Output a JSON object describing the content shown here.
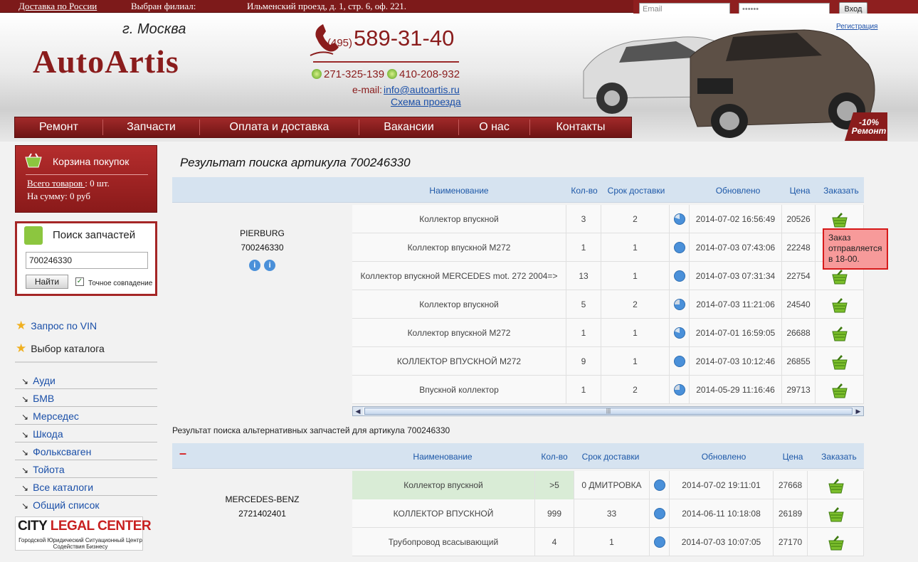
{
  "topbar": {
    "delivery": "Доставка по России",
    "branch_label": "Выбран филиал:",
    "branch_address": "Ильменский проезд, д. 1, стр. 6, оф. 221.",
    "email_placeholder": "Email",
    "password_mask": "••••••",
    "login_button": "Вход",
    "register": "Регистрация"
  },
  "header": {
    "city": "г. Москва",
    "logo": "AutoArtis",
    "code": "(495)",
    "phone": "589-31-40",
    "phone2": "271-325-139",
    "phone3": "410-208-932",
    "email_label": "e-mail:",
    "email": "info@autoartis.ru",
    "scheme": "Схема проезда",
    "badge_line1": "-10%",
    "badge_line2": "Ремонт"
  },
  "nav": [
    "Ремонт",
    "Запчасти",
    "Оплата и доставка",
    "Вакансии",
    "О нас",
    "Контакты"
  ],
  "cart": {
    "title": "Корзина покупок",
    "items_label": "Всего товаров ",
    "items_value": ": 0 шт.",
    "sum": "На сумму: 0 руб"
  },
  "search": {
    "title": "Поиск запчастей",
    "query": "700246330",
    "button": "Найти",
    "exact": "Точное совпадение",
    "exact_checked": true
  },
  "links": {
    "vin": "Запрос по VIN",
    "catalog": "Выбор каталога"
  },
  "catalogs": [
    "Ауди",
    "БМВ",
    "Мерседес",
    "Шкода",
    "Фольксваген",
    "Тойота",
    "Все каталоги",
    "Общий список"
  ],
  "banner": {
    "part1": "CITY ",
    "part2": "LEGAL CENTER",
    "sub": "Городской Юридический Ситуационный Центр Содействия Бизнесу"
  },
  "main": {
    "title": "Результат поиска артикула 700246330",
    "columns": [
      "Наименование",
      "Кол-во",
      "Срок доставки",
      "Обновлено",
      "Цена",
      "Заказать"
    ],
    "brand": "PIERBURG",
    "article": "700246330",
    "rows": [
      {
        "name": "Коллектор впускной",
        "qty": "3",
        "days": "2",
        "pie": "q",
        "updated": "2014-07-02 16:56:49",
        "price": "20526"
      },
      {
        "name": "Коллектор впускной M272",
        "qty": "1",
        "days": "1",
        "pie": "f",
        "updated": "2014-07-03 07:43:06",
        "price": "22248"
      },
      {
        "name": "Коллектор впускной MERCEDES mot. 272 2004=>",
        "qty": "13",
        "days": "1",
        "pie": "f",
        "updated": "2014-07-03 07:31:34",
        "price": "22754"
      },
      {
        "name": "Коллектор впускной",
        "qty": "5",
        "days": "2",
        "pie": "h",
        "updated": "2014-07-03 11:21:06",
        "price": "24540"
      },
      {
        "name": "Коллектор впускной M272",
        "qty": "1",
        "days": "1",
        "pie": "q",
        "updated": "2014-07-01 16:59:05",
        "price": "26688"
      },
      {
        "name": "КОЛЛЕКТОР ВПУСКНОЙ M272",
        "qty": "9",
        "days": "1",
        "pie": "f",
        "updated": "2014-07-03 10:12:46",
        "price": "26855"
      },
      {
        "name": "Впускной коллектор",
        "qty": "1",
        "days": "2",
        "pie": "h",
        "updated": "2014-05-29 11:16:46",
        "price": "29713"
      }
    ],
    "tooltip": "Заказ отправляется в 18-00."
  },
  "alt": {
    "title": "Результат поиска альтернативных запчастей для артикула 700246330",
    "collapse": "–",
    "columns": [
      "Наименование",
      "Кол-во",
      "Срок доставки",
      "Обновлено",
      "Цена",
      "Заказать"
    ],
    "brand": "MERCEDES-BENZ",
    "article": "2721402401",
    "rows": [
      {
        "name": "Коллектор впускной",
        "qty": ">5",
        "days": "0 ДМИТРОВКА",
        "updated": "2014-07-02 19:11:01",
        "price": "27668",
        "highlight": true
      },
      {
        "name": "КОЛЛЕКТОР ВПУСКНОЙ",
        "qty": "999",
        "days": "33",
        "updated": "2014-06-11 10:18:08",
        "price": "26189",
        "highlight": false
      },
      {
        "name": "Трубопровод всасывающий",
        "qty": "4",
        "days": "1",
        "updated": "2014-07-03 10:07:05",
        "price": "27170",
        "highlight": false
      }
    ]
  }
}
